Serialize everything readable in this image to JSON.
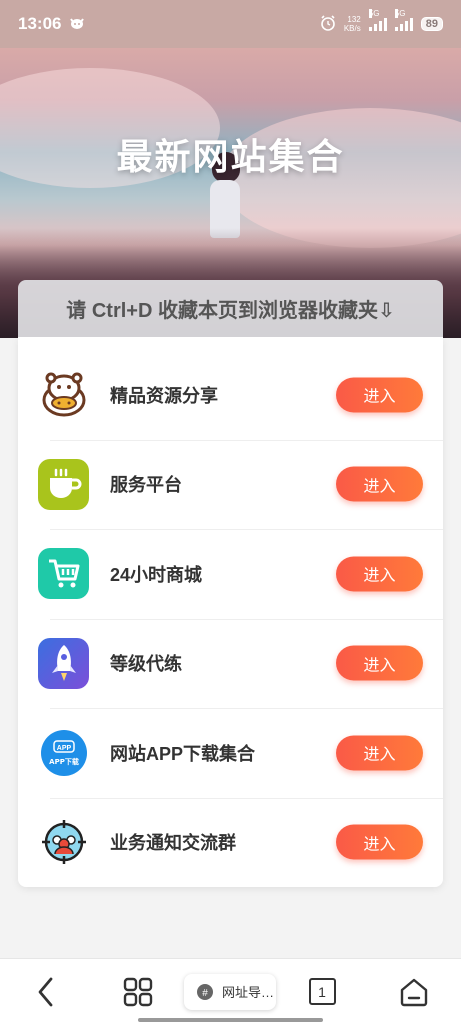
{
  "status_bar": {
    "time": "13:06",
    "speed_value": "132",
    "speed_unit": "KB/s",
    "signal1_label": "5G",
    "signal2_label": "5G",
    "battery": "89"
  },
  "hero": {
    "title": "最新网站集合"
  },
  "notice": "请 Ctrl+D 收藏本页到浏览器收藏夹⇩",
  "items": [
    {
      "label": "精品资源分享",
      "button": "进入",
      "icon": "hippo-icon"
    },
    {
      "label": "服务平台",
      "button": "进入",
      "icon": "cup-icon"
    },
    {
      "label": "24小时商城",
      "button": "进入",
      "icon": "cart-icon"
    },
    {
      "label": "等级代练",
      "button": "进入",
      "icon": "rocket-icon"
    },
    {
      "label": "网站APP下载集合",
      "button": "进入",
      "icon": "app-download-icon"
    },
    {
      "label": "业务通知交流群",
      "button": "进入",
      "icon": "group-icon"
    }
  ],
  "app_icon_text_top": "APP",
  "app_icon_text_bottom": "APP下载",
  "bottom_bar": {
    "url_label": "网址导…",
    "tab_count": "1"
  },
  "colors": {
    "button": "#fa5a47",
    "cup_bg": "#a9c41c",
    "cart_bg": "#1fc9a8",
    "rocket_bg": "#3b6fe0",
    "app_bg": "#1e8fe8"
  }
}
